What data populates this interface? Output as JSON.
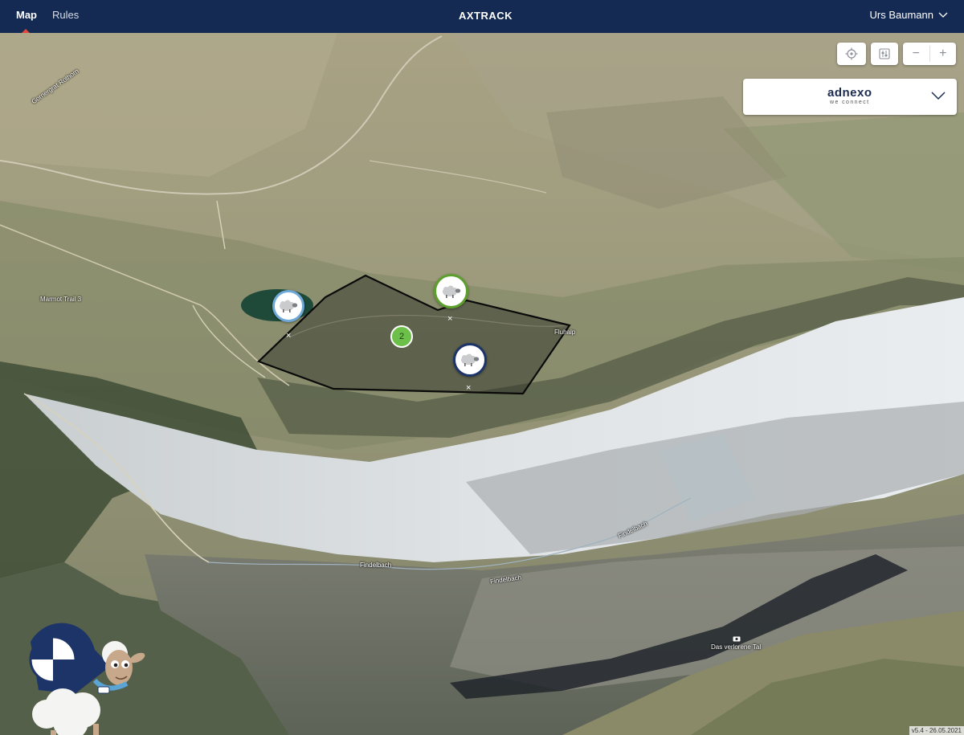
{
  "nav": {
    "items": [
      {
        "label": "Map",
        "active": true
      },
      {
        "label": "Rules",
        "active": false
      }
    ],
    "brand": "AXTRACK",
    "user": "Urs Baumann"
  },
  "organization": {
    "name": "adnexo",
    "tagline": "we connect"
  },
  "controls": {
    "zoom_out": "−",
    "zoom_in": "+"
  },
  "markers": {
    "cluster_count": "2",
    "remove_glyph": "×"
  },
  "map_labels": {
    "trail": "Marmot Trail 3",
    "hut": "Fluhalp",
    "stream_1": "Findelbach",
    "stream_2": "Findelbach",
    "stream_3": "Findelbach",
    "viewpoint": "Das verlorene Tal",
    "road": "Gornergrat Rothorn"
  },
  "footer": {
    "version": "v5.4 - 26.05.2021"
  },
  "colors": {
    "topbar": "#142a52",
    "accent": "#e04a3a",
    "marker_green": "#5ca02c",
    "marker_light": "#6fa9d8",
    "marker_navy": "#1d3468",
    "cluster": "#6cc04a"
  },
  "icons": [
    "locate-icon",
    "filter-icon",
    "chevron-down-icon",
    "sheep-icon",
    "camera-icon"
  ]
}
